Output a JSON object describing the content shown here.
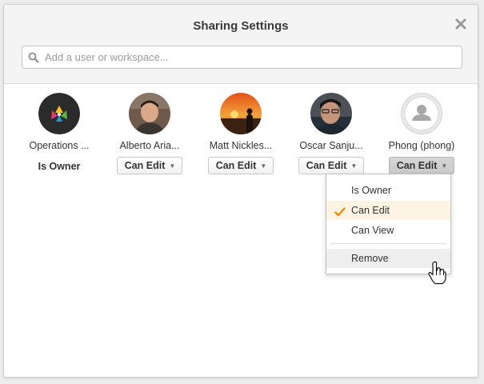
{
  "dialog": {
    "title": "Sharing Settings",
    "close_icon": "close-icon"
  },
  "search": {
    "placeholder": "Add a user or workspace...",
    "value": ""
  },
  "members": [
    {
      "name": "Operations ...",
      "role": "Is Owner",
      "avatar": "workspace-logo"
    },
    {
      "name": "Alberto Aria...",
      "role": "Can Edit",
      "avatar": "photo"
    },
    {
      "name": "Matt Nickles...",
      "role": "Can Edit",
      "avatar": "photo"
    },
    {
      "name": "Oscar Sanju...",
      "role": "Can Edit",
      "avatar": "photo"
    },
    {
      "name": "Phong (phong)",
      "role": "Can Edit",
      "avatar": "default-user-icon"
    }
  ],
  "dropdown": {
    "items": [
      {
        "label": "Is Owner",
        "selected": false
      },
      {
        "label": "Can Edit",
        "selected": true
      },
      {
        "label": "Can View",
        "selected": false
      },
      {
        "label": "Remove",
        "selected": false
      }
    ],
    "check_icon": "checkmark-icon",
    "check_color": "#f08c00"
  },
  "colors": {
    "accent_check": "#f08c00",
    "header_bg": "#f4f4f4"
  }
}
